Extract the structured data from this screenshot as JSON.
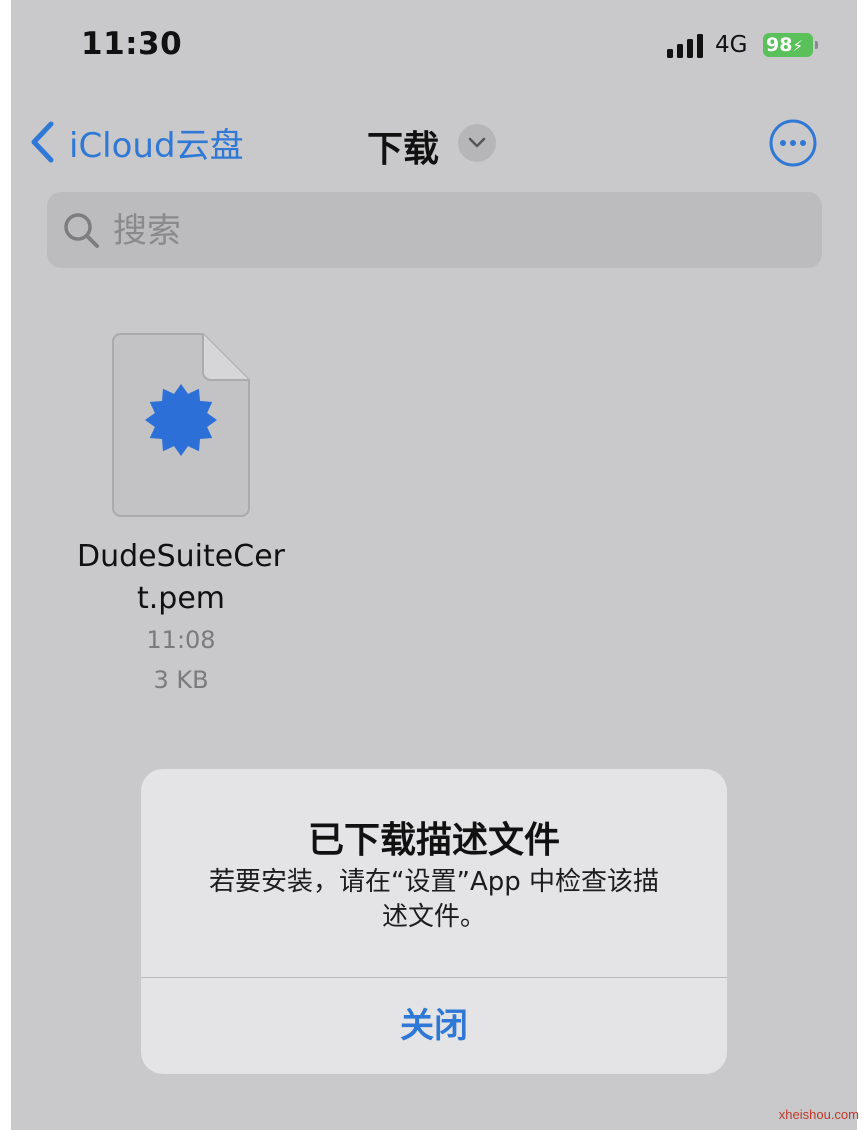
{
  "status_bar": {
    "time": "11:30",
    "network": "4G",
    "battery": "98",
    "battery_color": "#5ac05a",
    "icons": [
      "signal-icon",
      "battery-icon",
      "charging-bolt-icon"
    ]
  },
  "nav": {
    "back_label": "iCloud云盘",
    "title": "下载",
    "icons": [
      "chevron-left-icon",
      "chevron-down-icon",
      "more-icon"
    ],
    "accent_color": "#2f78d6"
  },
  "search": {
    "placeholder": "搜索",
    "icon": "search-icon"
  },
  "files": [
    {
      "name_line1": "DudeSuiteCer",
      "name_line2": "t.pem",
      "time": "11:08",
      "size": "3 KB",
      "icon": "certificate-file-icon"
    }
  ],
  "alert": {
    "title": "已下载描述文件",
    "message_line1": "若要安装，请在“设置”App 中检查该描",
    "message_line2": "述文件。",
    "button": "关闭"
  },
  "watermark": "xheishou.com"
}
